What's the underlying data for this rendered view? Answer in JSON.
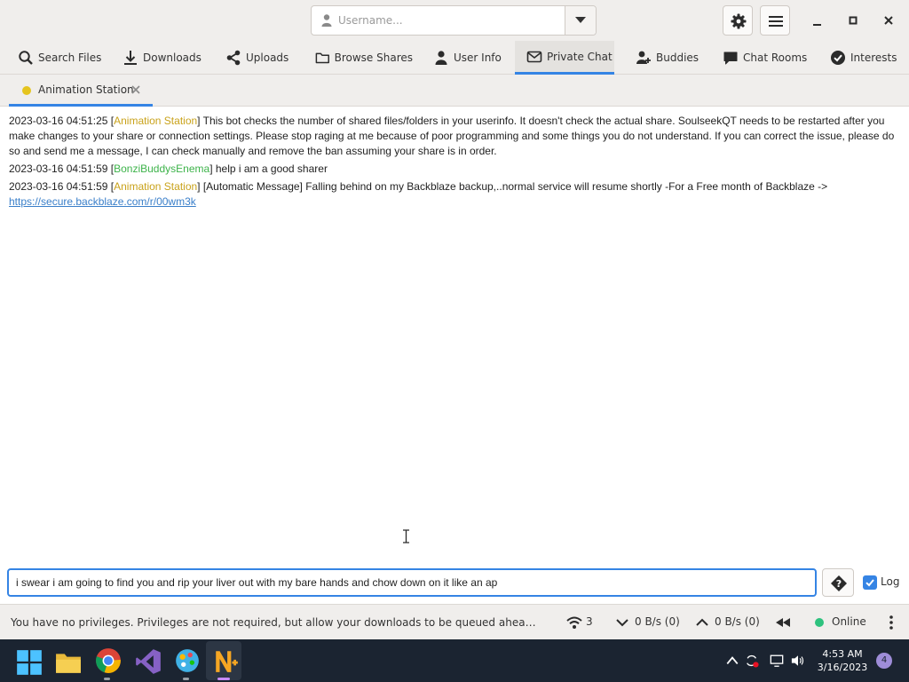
{
  "header": {
    "username_placeholder": "Username..."
  },
  "nav": {
    "tabs": [
      {
        "label": "Search Files",
        "icon": "search-icon"
      },
      {
        "label": "Downloads",
        "icon": "download-icon"
      },
      {
        "label": "Uploads",
        "icon": "share-icon"
      },
      {
        "label": "Browse Shares",
        "icon": "folder-icon"
      },
      {
        "label": "User Info",
        "icon": "person-icon"
      },
      {
        "label": "Private Chat",
        "icon": "envelope-icon",
        "active": true
      },
      {
        "label": "Buddies",
        "icon": "add-user-icon"
      },
      {
        "label": "Chat Rooms",
        "icon": "speech-bubble-icon"
      },
      {
        "label": "Interests",
        "icon": "check-circle-icon"
      }
    ]
  },
  "conversation_tab": {
    "label": "Animation Station",
    "status_color": "#e5c41e"
  },
  "messages": [
    {
      "time": "2023-03-16 04:51:25",
      "nick": "Animation Station",
      "text": "This bot checks the number of shared files/folders in your userinfo. It doesn't check the actual share. SoulseekQT needs to be restarted after you make changes to your share or connection settings. Please stop raging at me because of poor programming and some things you do not understand. If you can correct the issue, please do so and send me a message, I can check manually and remove the ban assuming your share is in order."
    },
    {
      "time": "2023-03-16 04:51:59",
      "nick": "BonziBuddysEnema",
      "text": "help i am a good sharer"
    },
    {
      "time": "2023-03-16 04:51:59",
      "nick": "Animation Station",
      "text": "[Automatic Message] Falling behind on my Backblaze backup,..normal service will resume shortly -For a Free month of Backblaze ->",
      "link": "https://secure.backblaze.com/r/00wm3k"
    }
  ],
  "input": {
    "value": "i swear i am going to find you and rip your liver out with my bare hands and chow down on it like an ap"
  },
  "log_checkbox": {
    "label": "Log",
    "checked": true
  },
  "status": {
    "message": "You have no privileges. Privileges are not required, but allow your downloads to be queued ahead of non-privileged users.",
    "connections": "3",
    "download_speed": "0 B/s (0)",
    "upload_speed": "0 B/s (0)",
    "online_label": "Online"
  },
  "taskbar": {
    "time": "4:53 AM",
    "date": "3/16/2023",
    "notification_count": "4"
  },
  "colors": {
    "accent": "#3584e4",
    "nick_animation_station": "#c9a21a",
    "nick_bonzibuddysenema": "#3db34a",
    "online": "#2ec27e"
  }
}
